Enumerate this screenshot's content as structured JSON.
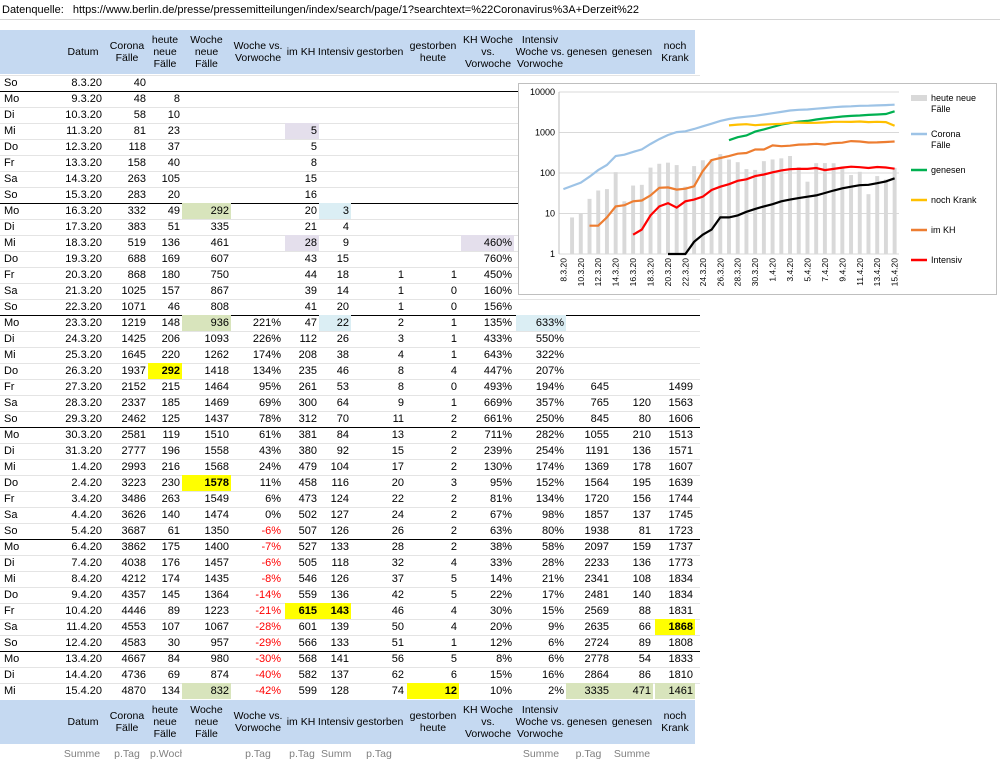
{
  "source": {
    "label": "Datenquelle:",
    "url": "https://www.berlin.de/presse/pressemitteilungen/index/search/page/1?searchtext=%22Coronavirus%3A+Derzeit%22"
  },
  "headers": [
    "Datum",
    "Corona Fälle",
    "heute neue Fälle",
    "Woche neue Fälle",
    "Woche vs. Vorwoche",
    "im KH",
    "Intensiv",
    "gestorben",
    "gestorben heute",
    "KH Woche vs. Vorwoche",
    "Intensiv Woche vs. Vorwoche",
    "genesen",
    "genesen",
    "noch Krank"
  ],
  "footer_units": [
    "",
    "Summe",
    "p.Tag",
    "p.Woche",
    "",
    "p.Tag",
    "p.Tag",
    "Summe",
    "p.Tag",
    "",
    "",
    "Summe",
    "p.Tag",
    "Summe"
  ],
  "rows": [
    [
      "So",
      "8.3.20",
      "40",
      "",
      "",
      "",
      "",
      "",
      "",
      "",
      "",
      "",
      "",
      "",
      ""
    ],
    [
      "Mo",
      "9.3.20",
      "48",
      "8",
      "",
      "",
      "",
      "",
      "",
      "",
      "",
      "",
      "",
      "",
      ""
    ],
    [
      "Di",
      "10.3.20",
      "58",
      "10",
      "",
      "",
      "",
      "",
      "",
      "",
      "",
      "",
      "",
      "",
      ""
    ],
    [
      "Mi",
      "11.3.20",
      "81",
      "23",
      "",
      "",
      "5",
      "",
      "",
      "",
      "",
      "",
      "",
      "",
      ""
    ],
    [
      "Do",
      "12.3.20",
      "118",
      "37",
      "",
      "",
      "5",
      "",
      "",
      "",
      "",
      "",
      "",
      "",
      ""
    ],
    [
      "Fr",
      "13.3.20",
      "158",
      "40",
      "",
      "",
      "8",
      "",
      "",
      "",
      "",
      "",
      "",
      "",
      ""
    ],
    [
      "Sa",
      "14.3.20",
      "263",
      "105",
      "",
      "",
      "15",
      "",
      "",
      "",
      "",
      "",
      "",
      "",
      ""
    ],
    [
      "So",
      "15.3.20",
      "283",
      "20",
      "",
      "",
      "16",
      "",
      "",
      "",
      "",
      "",
      "",
      "",
      ""
    ],
    [
      "Mo",
      "16.3.20",
      "332",
      "49",
      "292",
      "",
      "20",
      "3",
      "",
      "",
      "",
      "",
      "",
      "",
      ""
    ],
    [
      "Di",
      "17.3.20",
      "383",
      "51",
      "335",
      "",
      "21",
      "4",
      "",
      "",
      "",
      "",
      "",
      "",
      ""
    ],
    [
      "Mi",
      "18.3.20",
      "519",
      "136",
      "461",
      "",
      "28",
      "9",
      "",
      "",
      "460%",
      "",
      "",
      "",
      ""
    ],
    [
      "Do",
      "19.3.20",
      "688",
      "169",
      "607",
      "",
      "43",
      "15",
      "",
      "",
      "760%",
      "",
      "",
      "",
      ""
    ],
    [
      "Fr",
      "20.3.20",
      "868",
      "180",
      "750",
      "",
      "44",
      "18",
      "1",
      "1",
      "450%",
      "",
      "",
      "",
      ""
    ],
    [
      "Sa",
      "21.3.20",
      "1025",
      "157",
      "867",
      "",
      "39",
      "14",
      "1",
      "0",
      "160%",
      "",
      "",
      "",
      ""
    ],
    [
      "So",
      "22.3.20",
      "1071",
      "46",
      "808",
      "",
      "41",
      "20",
      "1",
      "0",
      "156%",
      "",
      "",
      "",
      ""
    ],
    [
      "Mo",
      "23.3.20",
      "1219",
      "148",
      "936",
      "221%",
      "47",
      "22",
      "2",
      "1",
      "135%",
      "633%",
      "",
      "",
      ""
    ],
    [
      "Di",
      "24.3.20",
      "1425",
      "206",
      "1093",
      "226%",
      "112",
      "26",
      "3",
      "1",
      "433%",
      "550%",
      "",
      "",
      ""
    ],
    [
      "Mi",
      "25.3.20",
      "1645",
      "220",
      "1262",
      "174%",
      "208",
      "38",
      "4",
      "1",
      "643%",
      "322%",
      "",
      "",
      ""
    ],
    [
      "Do",
      "26.3.20",
      "1937",
      "292",
      "1418",
      "134%",
      "235",
      "46",
      "8",
      "4",
      "447%",
      "207%",
      "",
      "",
      ""
    ],
    [
      "Fr",
      "27.3.20",
      "2152",
      "215",
      "1464",
      "95%",
      "261",
      "53",
      "8",
      "0",
      "493%",
      "194%",
      "645",
      "",
      "1499"
    ],
    [
      "Sa",
      "28.3.20",
      "2337",
      "185",
      "1469",
      "69%",
      "300",
      "64",
      "9",
      "1",
      "669%",
      "357%",
      "765",
      "120",
      "1563"
    ],
    [
      "So",
      "29.3.20",
      "2462",
      "125",
      "1437",
      "78%",
      "312",
      "70",
      "11",
      "2",
      "661%",
      "250%",
      "845",
      "80",
      "1606"
    ],
    [
      "Mo",
      "30.3.20",
      "2581",
      "119",
      "1510",
      "61%",
      "381",
      "84",
      "13",
      "2",
      "711%",
      "282%",
      "1055",
      "210",
      "1513"
    ],
    [
      "Di",
      "31.3.20",
      "2777",
      "196",
      "1558",
      "43%",
      "380",
      "92",
      "15",
      "2",
      "239%",
      "254%",
      "1191",
      "136",
      "1571"
    ],
    [
      "Mi",
      "1.4.20",
      "2993",
      "216",
      "1568",
      "24%",
      "479",
      "104",
      "17",
      "2",
      "130%",
      "174%",
      "1369",
      "178",
      "1607"
    ],
    [
      "Do",
      "2.4.20",
      "3223",
      "230",
      "1578",
      "11%",
      "458",
      "116",
      "20",
      "3",
      "95%",
      "152%",
      "1564",
      "195",
      "1639"
    ],
    [
      "Fr",
      "3.4.20",
      "3486",
      "263",
      "1549",
      "6%",
      "473",
      "124",
      "22",
      "2",
      "81%",
      "134%",
      "1720",
      "156",
      "1744"
    ],
    [
      "Sa",
      "4.4.20",
      "3626",
      "140",
      "1474",
      "0%",
      "502",
      "127",
      "24",
      "2",
      "67%",
      "98%",
      "1857",
      "137",
      "1745"
    ],
    [
      "So",
      "5.4.20",
      "3687",
      "61",
      "1350",
      "-6%",
      "507",
      "126",
      "26",
      "2",
      "63%",
      "80%",
      "1938",
      "81",
      "1723"
    ],
    [
      "Mo",
      "6.4.20",
      "3862",
      "175",
      "1400",
      "-7%",
      "527",
      "133",
      "28",
      "2",
      "38%",
      "58%",
      "2097",
      "159",
      "1737"
    ],
    [
      "Di",
      "7.4.20",
      "4038",
      "176",
      "1457",
      "-6%",
      "505",
      "118",
      "32",
      "4",
      "33%",
      "28%",
      "2233",
      "136",
      "1773"
    ],
    [
      "Mi",
      "8.4.20",
      "4212",
      "174",
      "1435",
      "-8%",
      "546",
      "126",
      "37",
      "5",
      "14%",
      "21%",
      "2341",
      "108",
      "1834"
    ],
    [
      "Do",
      "9.4.20",
      "4357",
      "145",
      "1364",
      "-14%",
      "559",
      "136",
      "42",
      "5",
      "22%",
      "17%",
      "2481",
      "140",
      "1834"
    ],
    [
      "Fr",
      "10.4.20",
      "4446",
      "89",
      "1223",
      "-21%",
      "615",
      "143",
      "46",
      "4",
      "30%",
      "15%",
      "2569",
      "88",
      "1831"
    ],
    [
      "Sa",
      "11.4.20",
      "4553",
      "107",
      "1067",
      "-28%",
      "601",
      "139",
      "50",
      "4",
      "20%",
      "9%",
      "2635",
      "66",
      "1868"
    ],
    [
      "So",
      "12.4.20",
      "4583",
      "30",
      "957",
      "-29%",
      "566",
      "133",
      "51",
      "1",
      "12%",
      "6%",
      "2724",
      "89",
      "1808"
    ],
    [
      "Mo",
      "13.4.20",
      "4667",
      "84",
      "980",
      "-30%",
      "568",
      "141",
      "56",
      "5",
      "8%",
      "6%",
      "2778",
      "54",
      "1833"
    ],
    [
      "Di",
      "14.4.20",
      "4736",
      "69",
      "874",
      "-40%",
      "582",
      "137",
      "62",
      "6",
      "15%",
      "16%",
      "2864",
      "86",
      "1810"
    ],
    [
      "Mi",
      "15.4.20",
      "4870",
      "134",
      "832",
      "-42%",
      "599",
      "128",
      "74",
      "12",
      "10%",
      "2%",
      "3335",
      "471",
      "1461"
    ]
  ],
  "chart_data": {
    "type": "line",
    "yscale": "log",
    "ylim": [
      1,
      10000
    ],
    "yticks": [
      "10000",
      "1000",
      "100",
      "10",
      "1"
    ],
    "x_tick_labels": [
      "8.3.20",
      "10.3.20",
      "12.3.20",
      "14.3.20",
      "16.3.20",
      "18.3.20",
      "20.3.20",
      "22.3.20",
      "24.3.20",
      "26.3.20",
      "28.3.20",
      "30.3.20",
      "1.4.20",
      "3.4.20",
      "5.4.20",
      "7.4.20",
      "9.4.20",
      "11.4.20",
      "13.4.20",
      "15.4.20"
    ],
    "x": [
      "8.3.20",
      "9.3.20",
      "10.3.20",
      "11.3.20",
      "12.3.20",
      "13.3.20",
      "14.3.20",
      "15.3.20",
      "16.3.20",
      "17.3.20",
      "18.3.20",
      "19.3.20",
      "20.3.20",
      "21.3.20",
      "22.3.20",
      "23.3.20",
      "24.3.20",
      "25.3.20",
      "26.3.20",
      "27.3.20",
      "28.3.20",
      "29.3.20",
      "30.3.20",
      "31.3.20",
      "1.4.20",
      "2.4.20",
      "3.4.20",
      "4.4.20",
      "5.4.20",
      "6.4.20",
      "7.4.20",
      "8.4.20",
      "9.4.20",
      "10.4.20",
      "11.4.20",
      "12.4.20",
      "13.4.20",
      "14.4.20",
      "15.4.20"
    ],
    "bars": {
      "name": "heute neue Fälle",
      "color": "#d9d9d9",
      "values": [
        null,
        8,
        10,
        23,
        37,
        40,
        105,
        20,
        49,
        51,
        136,
        169,
        180,
        157,
        46,
        148,
        206,
        220,
        292,
        215,
        185,
        125,
        119,
        196,
        216,
        230,
        263,
        140,
        61,
        175,
        176,
        174,
        145,
        89,
        107,
        30,
        84,
        69,
        134
      ]
    },
    "series": [
      {
        "name": "Corona Fälle",
        "color": "#9dc3e6",
        "values": [
          40,
          48,
          58,
          81,
          118,
          158,
          263,
          283,
          332,
          383,
          519,
          688,
          868,
          1025,
          1071,
          1219,
          1425,
          1645,
          1937,
          2152,
          2337,
          2462,
          2581,
          2777,
          2993,
          3223,
          3486,
          3626,
          3687,
          3862,
          4038,
          4212,
          4357,
          4446,
          4553,
          4583,
          4667,
          4736,
          4870
        ]
      },
      {
        "name": "genesen",
        "color": "#00b050",
        "values": [
          null,
          null,
          null,
          null,
          null,
          null,
          null,
          null,
          null,
          null,
          null,
          null,
          null,
          null,
          null,
          null,
          null,
          null,
          null,
          645,
          765,
          845,
          1055,
          1191,
          1369,
          1564,
          1720,
          1857,
          1938,
          2097,
          2233,
          2341,
          2481,
          2569,
          2635,
          2724,
          2778,
          2864,
          3335
        ]
      },
      {
        "name": "noch Krank",
        "color": "#ffc000",
        "values": [
          null,
          null,
          null,
          null,
          null,
          null,
          null,
          null,
          null,
          null,
          null,
          null,
          null,
          null,
          null,
          null,
          null,
          null,
          null,
          1499,
          1563,
          1606,
          1513,
          1571,
          1607,
          1639,
          1744,
          1745,
          1723,
          1737,
          1773,
          1834,
          1834,
          1831,
          1868,
          1808,
          1833,
          1810,
          1461
        ]
      },
      {
        "name": "im KH",
        "color": "#ed7d31",
        "values": [
          null,
          null,
          null,
          5,
          5,
          8,
          15,
          16,
          20,
          21,
          28,
          43,
          44,
          39,
          41,
          47,
          112,
          208,
          235,
          261,
          300,
          312,
          381,
          380,
          479,
          458,
          473,
          502,
          507,
          527,
          505,
          546,
          559,
          615,
          601,
          566,
          568,
          582,
          599
        ]
      },
      {
        "name": "Intensiv",
        "color": "#ff0000",
        "values": [
          null,
          null,
          null,
          null,
          null,
          null,
          null,
          null,
          3,
          4,
          9,
          15,
          18,
          14,
          20,
          22,
          26,
          38,
          46,
          53,
          64,
          70,
          84,
          92,
          104,
          116,
          124,
          127,
          126,
          133,
          118,
          126,
          136,
          143,
          139,
          133,
          141,
          137,
          128
        ]
      },
      {
        "name": "gestorben",
        "color": "#000000",
        "values": [
          null,
          null,
          null,
          null,
          null,
          null,
          null,
          null,
          null,
          null,
          null,
          null,
          1,
          1,
          1,
          2,
          3,
          4,
          8,
          8,
          9,
          11,
          13,
          15,
          17,
          20,
          22,
          24,
          26,
          28,
          32,
          37,
          42,
          46,
          50,
          51,
          56,
          62,
          74
        ]
      }
    ],
    "legend": [
      "heute neue Fälle",
      "Corona Fälle",
      "genesen",
      "noch Krank",
      "im KH",
      "Intensiv"
    ],
    "legend_position": "right"
  }
}
